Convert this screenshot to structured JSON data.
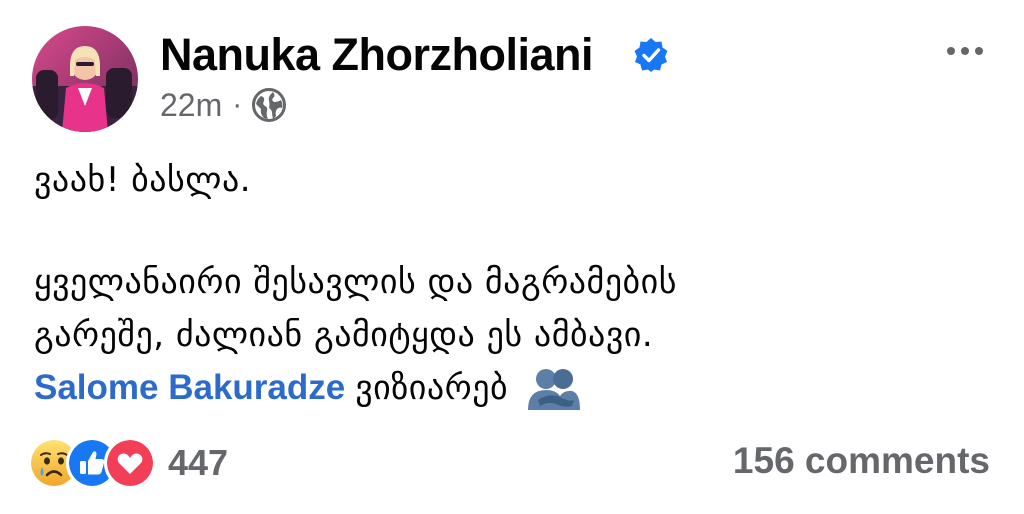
{
  "author": {
    "name": "Nanuka Zhorzholiani",
    "verified": true
  },
  "meta": {
    "time": "22m",
    "separator": "·",
    "audience_icon": "globe-icon"
  },
  "post": {
    "line1": "ვაახ! ბასლა.",
    "line2": "ყველანაირი შესავლის და მაგრამების",
    "line3": "გარეშე, ძალიან გამიტყდა ეს ამბავი.",
    "mention": "Salome Bakuradze",
    "line4_tail": "ვიზიარებ",
    "emoji_icon": "people-hugging-icon"
  },
  "reactions": {
    "icons": [
      "sad-icon",
      "like-icon",
      "love-icon"
    ],
    "count": "447"
  },
  "comments": {
    "label": "156 comments"
  },
  "colors": {
    "text": "#050505",
    "secondary": "#65676b",
    "link": "#2c6bcc",
    "verified": "#1877f2",
    "like": "#1877f2",
    "love": "#f33e58",
    "sad": "#f7b125"
  }
}
